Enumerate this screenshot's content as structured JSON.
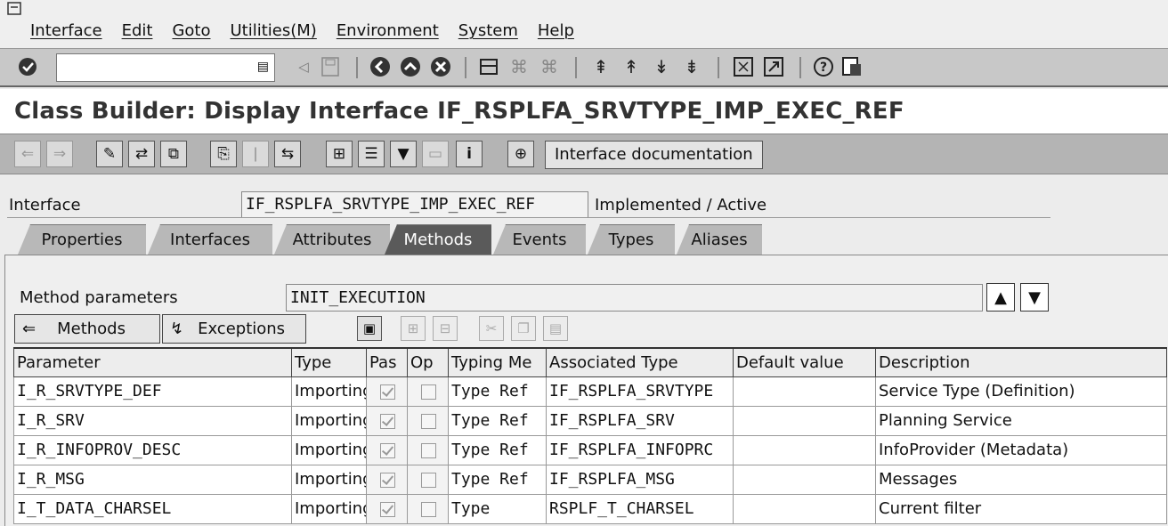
{
  "menu": [
    "Interface",
    "Edit",
    "Goto",
    "Utilities(M)",
    "Environment",
    "System",
    "Help"
  ],
  "command_field": {
    "value": ""
  },
  "title": "Class Builder: Display Interface IF_RSPLFA_SRVTYPE_IMP_EXEC_REF",
  "app_toolbar": {
    "doc_button": "Interface documentation"
  },
  "header": {
    "interface_label": "Interface",
    "interface_value": "IF_RSPLFA_SRVTYPE_IMP_EXEC_REF",
    "status": "Implemented / Active"
  },
  "tabs": [
    {
      "label": "Properties",
      "active": false
    },
    {
      "label": "Interfaces",
      "active": false
    },
    {
      "label": "Attributes",
      "active": false
    },
    {
      "label": "Methods",
      "active": true
    },
    {
      "label": "Events",
      "active": false
    },
    {
      "label": "Types",
      "active": false
    },
    {
      "label": "Aliases",
      "active": false
    }
  ],
  "method_params": {
    "label": "Method parameters",
    "value": "INIT_EXECUTION"
  },
  "buttons": {
    "methods": "Methods",
    "exceptions": "Exceptions"
  },
  "table": {
    "columns": [
      "Parameter",
      "Type",
      "Pas",
      "Op",
      "Typing Me",
      "Associated Type",
      "Default value",
      "Description"
    ],
    "rows": [
      {
        "parameter": "I_R_SRVTYPE_DEF",
        "type": "Importing",
        "pass_value": true,
        "optional": false,
        "typing": "Type Ref",
        "assoc": "IF_RSPLFA_SRVTYPE",
        "default": "",
        "description": "Service Type (Definition)"
      },
      {
        "parameter": "I_R_SRV",
        "type": "Importing",
        "pass_value": true,
        "optional": false,
        "typing": "Type Ref",
        "assoc": "IF_RSPLFA_SRV",
        "default": "",
        "description": "Planning Service"
      },
      {
        "parameter": "I_R_INFOPROV_DESC",
        "type": "Importing",
        "pass_value": true,
        "optional": false,
        "typing": "Type Ref",
        "assoc": "IF_RSPLFA_INFOPRC",
        "default": "",
        "description": "InfoProvider (Metadata)"
      },
      {
        "parameter": "I_R_MSG",
        "type": "Importing",
        "pass_value": true,
        "optional": false,
        "typing": "Type Ref",
        "assoc": "IF_RSPLFA_MSG",
        "default": "",
        "description": "Messages"
      },
      {
        "parameter": "I_T_DATA_CHARSEL",
        "type": "Importing",
        "pass_value": true,
        "optional": false,
        "typing": "Type",
        "assoc": "RSPLF_T_CHARSEL",
        "default": "",
        "description": "Current filter"
      }
    ]
  }
}
